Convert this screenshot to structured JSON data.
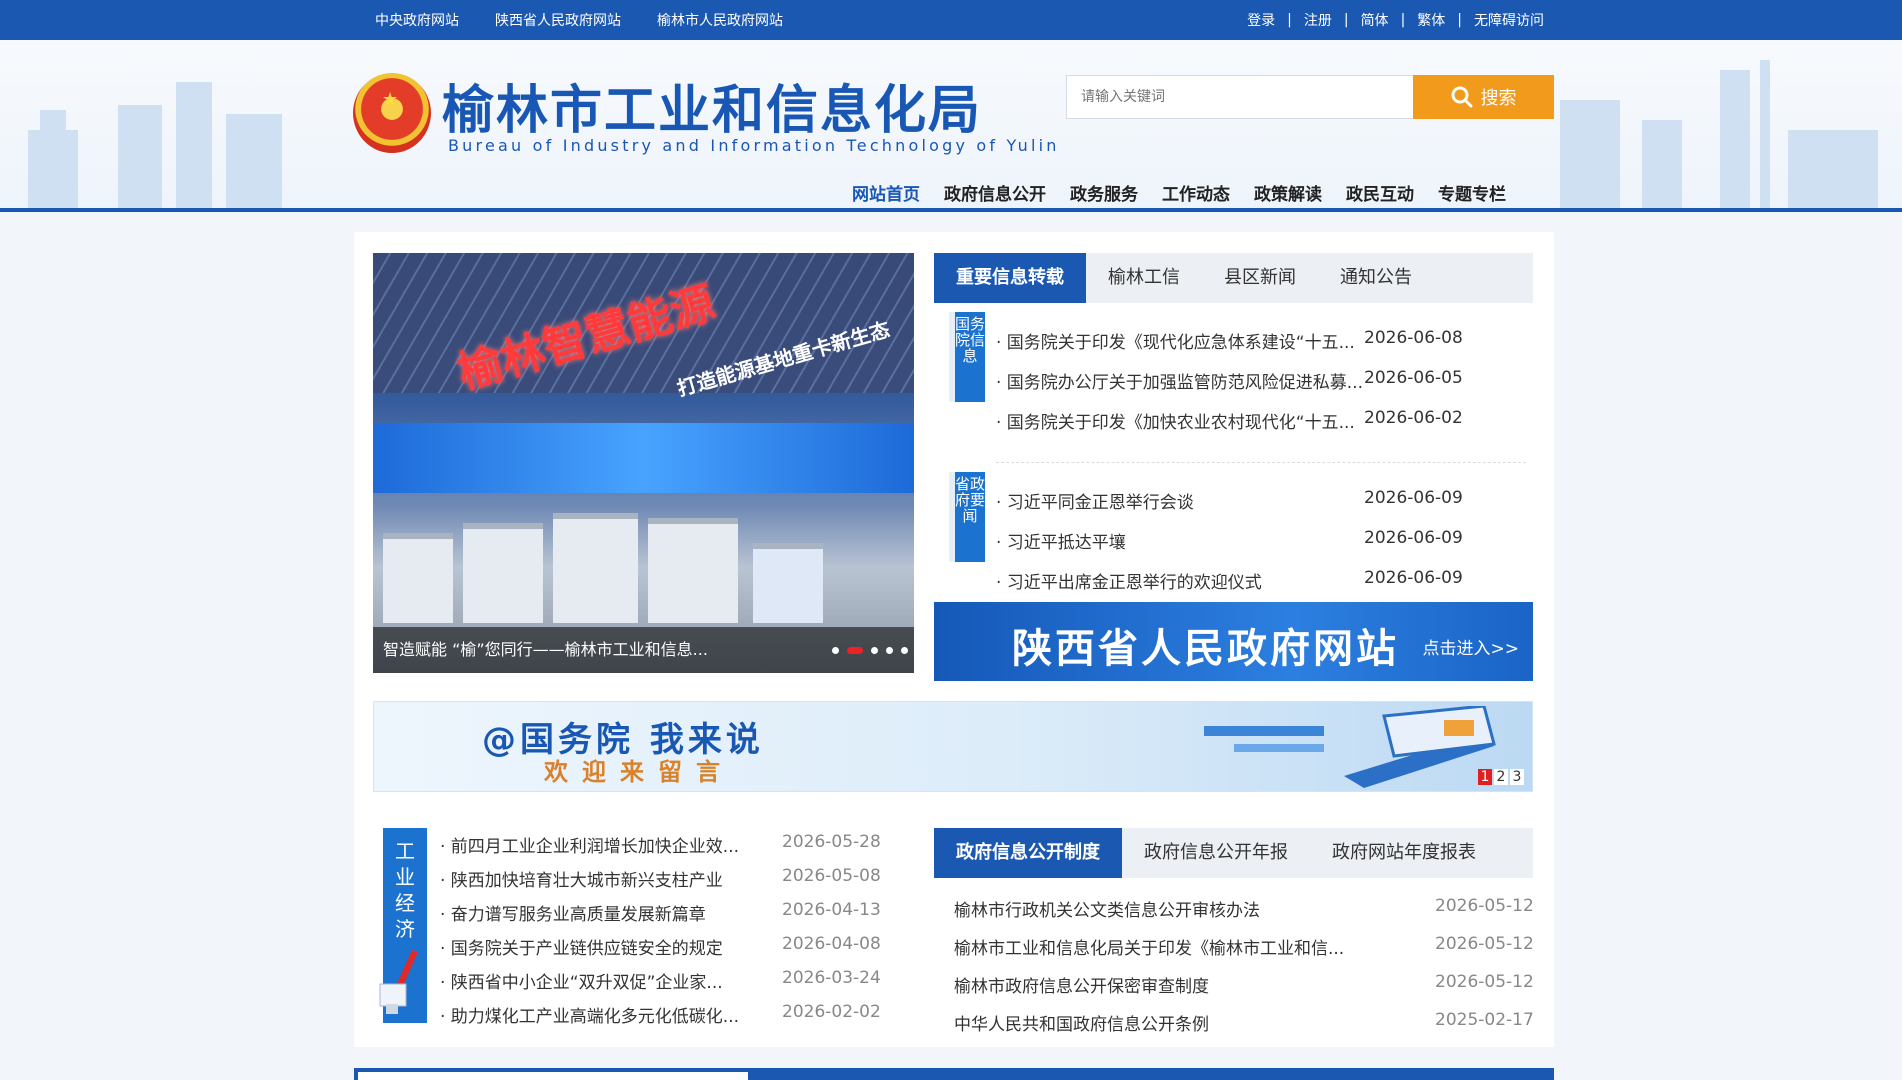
{
  "topbar": {
    "left_links": [
      "中央政府网站",
      "陕西省人民政府网站",
      "榆林市人民政府网站"
    ],
    "right_links": [
      "登录",
      "注册",
      "简体",
      "繁体",
      "无障碍访问"
    ],
    "separator": "|"
  },
  "header": {
    "title": "榆林市工业和信息化局",
    "subtitle": "Bureau of Industry and Information Technology of Yulin"
  },
  "search": {
    "placeholder": "请输入关键词",
    "button_label": "搜索"
  },
  "nav": {
    "items": [
      "网站首页",
      "政府信息公开",
      "政务服务",
      "工作动态",
      "政策解读",
      "政民互动",
      "专题专栏"
    ],
    "active_index": 0
  },
  "slider": {
    "sign_text": "榆林智慧能源",
    "sign_sub": "打造能源基地重卡新生态",
    "caption": "智造赋能 “榆”您同行——榆林市工业和信息...",
    "slide_count": 5,
    "active_slide": 1
  },
  "news_tabs": {
    "items": [
      "重要信息转载",
      "榆林工信",
      "县区新闻",
      "通知公告"
    ],
    "active_index": 0,
    "groups": [
      {
        "label": "国务院信息",
        "items": [
          {
            "title": "国务院关于印发《现代化应急体系建设“十五...",
            "date": "2026-06-08"
          },
          {
            "title": "国务院办公厅关于加强监管防范风险促进私募...",
            "date": "2026-06-05"
          },
          {
            "title": "国务院关于印发《加快农业农村现代化“十五...",
            "date": "2026-06-02"
          }
        ]
      },
      {
        "label": "省政府要闻",
        "items": [
          {
            "title": "习近平同金正恩举行会谈",
            "date": "2026-06-09"
          },
          {
            "title": "习近平抵达平壤",
            "date": "2026-06-09"
          },
          {
            "title": "习近平出席金正恩举行的欢迎仪式",
            "date": "2026-06-09"
          }
        ]
      }
    ]
  },
  "banner_shaanxi": {
    "title": "陕西省人民政府网站",
    "action": "点击进入>>"
  },
  "banner_guowuyuan": {
    "title": "@国务院 我来说",
    "subtitle": "欢迎来留言",
    "pages": [
      "1",
      "2",
      "3"
    ],
    "active_page": 0
  },
  "industry": {
    "label": "工业经济",
    "items": [
      {
        "title": "前四月工业企业利润增长加快企业效...",
        "date": "2026-05-28"
      },
      {
        "title": "陕西加快培育壮大城市新兴支柱产业",
        "date": "2026-05-08"
      },
      {
        "title": "奋力谱写服务业高质量发展新篇章",
        "date": "2026-04-13"
      },
      {
        "title": "国务院关于产业链供应链安全的规定",
        "date": "2026-04-08"
      },
      {
        "title": "陕西省中小企业“双升双促”企业家...",
        "date": "2026-03-24"
      },
      {
        "title": "助力煤化工产业高端化多元化低碳化...",
        "date": "2026-02-02"
      }
    ]
  },
  "gov_tabs": {
    "items": [
      "政府信息公开制度",
      "政府信息公开年报",
      "政府网站年度报表"
    ],
    "active_index": 0,
    "items_list": [
      {
        "title": "榆林市行政机关公文类信息公开审核办法",
        "date": "2026-05-12"
      },
      {
        "title": "榆林市工业和信息化局关于印发《榆林市工业和信...",
        "date": "2026-05-12"
      },
      {
        "title": "榆林市政府信息公开保密审查制度",
        "date": "2026-05-12"
      },
      {
        "title": "中华人民共和国政府信息公开条例",
        "date": "2025-02-17"
      }
    ]
  },
  "colors": {
    "brand_blue": "#1b58b1",
    "accent_orange": "#f29a1b",
    "alert_red": "#e02020"
  }
}
